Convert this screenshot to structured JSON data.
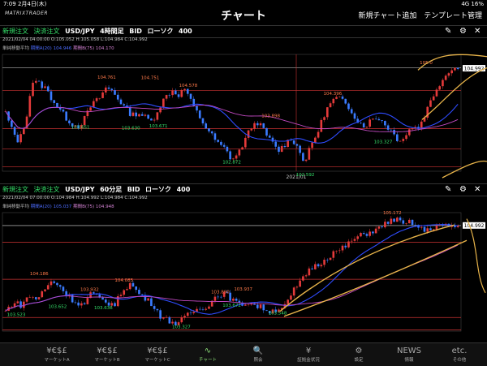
{
  "status": {
    "time": "7:09",
    "date": "2月4日(木)",
    "right": "4G 16%"
  },
  "header": {
    "logo": "MATRIXTRADER",
    "title": "チャート",
    "add_chart": "新規チャート追加",
    "template": "テンプレート管理"
  },
  "charts": [
    {
      "new_order": "新規注文",
      "settle_order": "決済注文",
      "pair": "USD/JPY",
      "timeframe": "4時間足",
      "side": "BID",
      "type": "ローソク",
      "count": "400",
      "ohlc": "2021/02/04 04:00:00  O:105.052  H:105.058  L:104.984  C:104.992",
      "ma_title": "単純移動平均",
      "ma_short": "期間A(20) 104.946",
      "ma_long": "期間B(75) 104.170",
      "current_price": "104.992",
      "date_label": "2021/01",
      "ymin": 102.7,
      "ymax": 105.3,
      "hlines": [
        105.0,
        104.5,
        103.65,
        103.2,
        102.8
      ],
      "labels": [
        {
          "text": "104.761",
          "x": 0.207,
          "y": 104.761,
          "c": "#ff7a4a"
        },
        {
          "text": "104.751",
          "x": 0.302,
          "y": 104.751,
          "c": "#ff7a4a"
        },
        {
          "text": "104.578",
          "x": 0.385,
          "y": 104.578,
          "c": "#ff7a4a"
        },
        {
          "text": "103.651",
          "x": 0.15,
          "y": 103.651,
          "c": "#35e06a"
        },
        {
          "text": "103.630",
          "x": 0.26,
          "y": 103.63,
          "c": "#35e06a"
        },
        {
          "text": "103.671",
          "x": 0.32,
          "y": 103.671,
          "c": "#35e06a"
        },
        {
          "text": "103.898",
          "x": 0.565,
          "y": 103.898,
          "c": "#ff7a4a"
        },
        {
          "text": "102.872",
          "x": 0.48,
          "y": 102.872,
          "c": "#35e06a"
        },
        {
          "text": "102.592",
          "x": 0.64,
          "y": 102.592,
          "c": "#35e06a"
        },
        {
          "text": "104.396",
          "x": 0.7,
          "y": 104.396,
          "c": "#ff7a4a"
        },
        {
          "text": "103.327",
          "x": 0.81,
          "y": 103.327,
          "c": "#35e06a"
        },
        {
          "text": "105.0",
          "x": 0.91,
          "y": 105.08,
          "c": "#ff7a4a"
        }
      ],
      "series": [
        104.0,
        103.6,
        103.35,
        103.8,
        104.7,
        104.65,
        104.55,
        104.3,
        104.1,
        103.9,
        103.75,
        103.7,
        103.9,
        104.2,
        104.3,
        104.55,
        104.5,
        104.3,
        104.1,
        103.95,
        104.0,
        103.9,
        103.8,
        104.1,
        104.35,
        104.5,
        104.4,
        104.55,
        104.2,
        103.95,
        103.7,
        103.5,
        103.3,
        103.2,
        102.95,
        103.1,
        103.4,
        103.7,
        103.8,
        103.55,
        103.35,
        103.15,
        103.3,
        103.45,
        103.2,
        102.9,
        103.3,
        103.6,
        104.0,
        104.25,
        104.35,
        104.2,
        104.05,
        103.8,
        103.7,
        103.85,
        103.9,
        103.75,
        103.6,
        103.4,
        103.45,
        103.7,
        103.65,
        103.95,
        104.3,
        104.6,
        104.8,
        105.0,
        104.99
      ]
    },
    {
      "new_order": "新規注文",
      "settle_order": "決済注文",
      "pair": "USD/JPY",
      "timeframe": "60分足",
      "side": "BID",
      "type": "ローソク",
      "count": "400",
      "ohlc": "2021/02/04 07:00:00  O:104.984  H:104.992  L:104.984  C:104.992",
      "ma_title": "単純移動平均",
      "ma_short": "期間A(20) 105.037",
      "ma_long": "期間B(75) 104.948",
      "current_price": "104.992",
      "date_label": "",
      "ymin": 103.28,
      "ymax": 105.2,
      "hlines": [
        104.99,
        104.72,
        104.12,
        103.5,
        103.3
      ],
      "labels": [
        {
          "text": "104.186",
          "x": 0.06,
          "y": 104.186,
          "c": "#ff7a4a"
        },
        {
          "text": "103.932",
          "x": 0.17,
          "y": 103.932,
          "c": "#ff7a4a"
        },
        {
          "text": "104.085",
          "x": 0.245,
          "y": 104.085,
          "c": "#ff7a4a"
        },
        {
          "text": "103.523",
          "x": 0.01,
          "y": 103.523,
          "c": "#35e06a"
        },
        {
          "text": "103.652",
          "x": 0.1,
          "y": 103.652,
          "c": "#35e06a"
        },
        {
          "text": "103.636",
          "x": 0.2,
          "y": 103.636,
          "c": "#35e06a"
        },
        {
          "text": "103.327",
          "x": 0.37,
          "y": 103.327,
          "c": "#35e06a"
        },
        {
          "text": "103.890",
          "x": 0.455,
          "y": 103.89,
          "c": "#ff7a4a"
        },
        {
          "text": "103.937",
          "x": 0.505,
          "y": 103.937,
          "c": "#ff7a4a"
        },
        {
          "text": "103.672",
          "x": 0.48,
          "y": 103.672,
          "c": "#35e06a"
        },
        {
          "text": "103.548",
          "x": 0.58,
          "y": 103.548,
          "c": "#35e06a"
        },
        {
          "text": "105.172",
          "x": 0.83,
          "y": 105.172,
          "c": "#ff7a4a"
        }
      ],
      "series": [
        103.6,
        103.75,
        103.7,
        103.85,
        103.8,
        103.95,
        104.1,
        104.0,
        103.85,
        103.75,
        103.7,
        103.9,
        103.8,
        103.75,
        103.7,
        103.95,
        104.05,
        103.9,
        103.8,
        103.7,
        103.5,
        103.45,
        103.4,
        103.5,
        103.6,
        103.65,
        103.7,
        103.85,
        103.9,
        103.8,
        103.7,
        103.75,
        103.7,
        103.65,
        103.6,
        103.65,
        103.7,
        103.95,
        104.1,
        104.3,
        104.35,
        104.45,
        104.55,
        104.6,
        104.7,
        104.8,
        104.85,
        104.9,
        104.95,
        105.05,
        105.1,
        105.0,
        105.05,
        104.95,
        104.9,
        104.98,
        105.0,
        104.95,
        104.99
      ]
    }
  ],
  "tabs": [
    {
      "icon": "¥€$£",
      "label": "マーケットA"
    },
    {
      "icon": "¥€$£",
      "label": "マーケットB"
    },
    {
      "icon": "¥€$£",
      "label": "マーケットC"
    },
    {
      "icon": "∿",
      "label": "チャート"
    },
    {
      "icon": "🔍",
      "label": "照会"
    },
    {
      "icon": "¥",
      "label": "証拠金状況"
    },
    {
      "icon": "⚙",
      "label": "設定"
    },
    {
      "icon": "NEWS",
      "label": "情報"
    },
    {
      "icon": "etc.",
      "label": "その他"
    }
  ],
  "colors": {
    "up": "#e43a3a",
    "down": "#3a7bff",
    "ma_short": "#2f4cff",
    "ma_long": "#c24ac2",
    "accent": "#8fe37b",
    "annot": "#e8b44a"
  }
}
